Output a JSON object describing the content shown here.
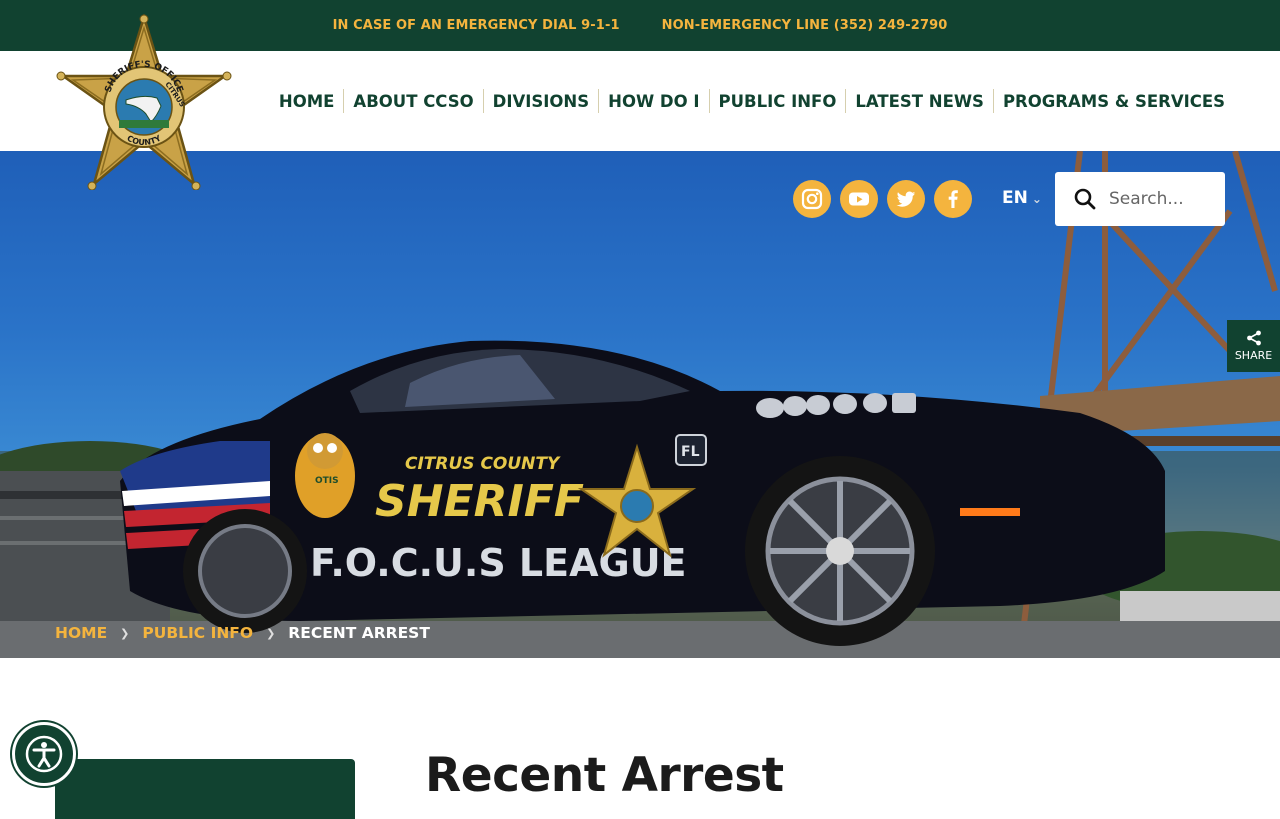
{
  "topbar": {
    "emergency": "IN CASE OF AN EMERGENCY DIAL 9-1-1",
    "non_emergency": "NON-EMERGENCY LINE (352) 249-2790"
  },
  "logo": {
    "ring_top": "SHERIFF'S OFFICE",
    "ring_inner": "CITRUS",
    "ring_bottom": "COUNTY"
  },
  "nav": [
    {
      "label": "HOME"
    },
    {
      "label": "ABOUT CCSO"
    },
    {
      "label": "DIVISIONS"
    },
    {
      "label": "HOW DO I"
    },
    {
      "label": "PUBLIC INFO"
    },
    {
      "label": "LATEST NEWS"
    },
    {
      "label": "PROGRAMS & SERVICES"
    }
  ],
  "social": [
    {
      "icon": "instagram-icon"
    },
    {
      "icon": "youtube-icon"
    },
    {
      "icon": "twitter-icon"
    },
    {
      "icon": "facebook-icon"
    }
  ],
  "language": {
    "label": "EN"
  },
  "search": {
    "placeholder": "Search..."
  },
  "share": {
    "label": "SHARE"
  },
  "car": {
    "line1": "CITRUS COUNTY",
    "line2": "SHERIFF",
    "line3": "F.O.C.U.S LEAGUE",
    "mascot": "OTIS",
    "plate_mark": "FL"
  },
  "breadcrumb": {
    "home": "HOME",
    "section": "PUBLIC INFO",
    "current": "RECENT ARREST"
  },
  "page": {
    "title": "Recent Arrest"
  },
  "colors": {
    "brand_green": "#114230",
    "gold": "#f4b43e"
  }
}
